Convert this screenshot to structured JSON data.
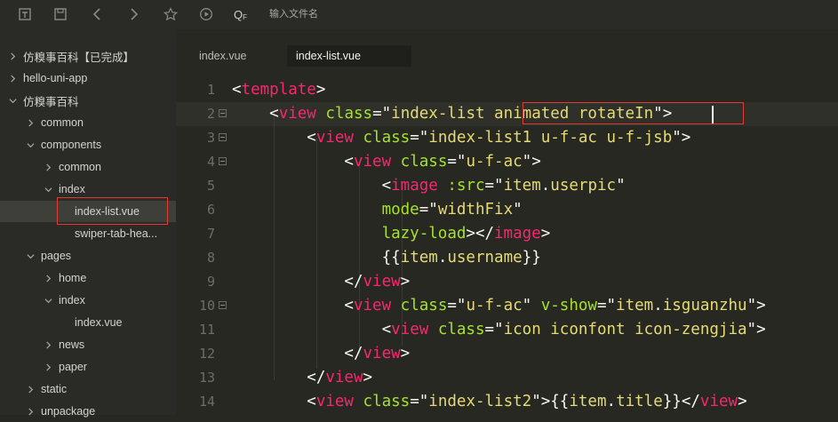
{
  "toolbar": {
    "icons": [
      "new-file-icon",
      "save-icon",
      "back-icon",
      "forward-icon",
      "star-icon",
      "run-icon"
    ],
    "search_glyph": "Q",
    "search_subscript": "F",
    "search_placeholder": "输入文件名"
  },
  "sidebar": {
    "items": [
      {
        "label": "仿糗事百科【已完成】",
        "expanded": false
      },
      {
        "label": "hello-uni-app",
        "expanded": false
      },
      {
        "label": "仿糗事百科",
        "expanded": true
      },
      {
        "label": "common",
        "expanded": false
      },
      {
        "label": "components",
        "expanded": true
      },
      {
        "label": "common",
        "expanded": false
      },
      {
        "label": "index",
        "expanded": true
      },
      {
        "label": "index-list.vue",
        "selected": true
      },
      {
        "label": "swiper-tab-hea..."
      },
      {
        "label": "pages",
        "expanded": true
      },
      {
        "label": "home",
        "expanded": false
      },
      {
        "label": "index",
        "expanded": true
      },
      {
        "label": "index.vue"
      },
      {
        "label": "news",
        "expanded": false
      },
      {
        "label": "paper",
        "expanded": false
      },
      {
        "label": "static",
        "expanded": false
      },
      {
        "label": "unpackage",
        "expanded": false
      }
    ]
  },
  "tabs": [
    {
      "label": "index.vue",
      "active": false
    },
    {
      "label": "index-list.vue",
      "active": true
    }
  ],
  "editor": {
    "lines": [
      {
        "n": "1",
        "parts": [
          [
            "t",
            "<"
          ],
          [
            "tag",
            "template"
          ],
          [
            "t",
            ">"
          ]
        ]
      },
      {
        "n": "2",
        "parts": [
          [
            "t",
            "    <"
          ],
          [
            "tag",
            "view"
          ],
          [
            "t",
            " "
          ],
          [
            "attr",
            "class"
          ],
          [
            "t",
            "=\""
          ],
          [
            "str",
            "index-list animated rotateIn"
          ],
          [
            "t",
            "\">"
          ]
        ]
      },
      {
        "n": "3",
        "parts": [
          [
            "t",
            "        <"
          ],
          [
            "tag",
            "view"
          ],
          [
            "t",
            " "
          ],
          [
            "attr",
            "class"
          ],
          [
            "t",
            "=\""
          ],
          [
            "str",
            "index-list1 u-f-ac u-f-jsb"
          ],
          [
            "t",
            "\">"
          ]
        ]
      },
      {
        "n": "4",
        "parts": [
          [
            "t",
            "            <"
          ],
          [
            "tag",
            "view"
          ],
          [
            "t",
            " "
          ],
          [
            "attr",
            "class"
          ],
          [
            "t",
            "=\""
          ],
          [
            "str",
            "u-f-ac"
          ],
          [
            "t",
            "\">"
          ]
        ]
      },
      {
        "n": "5",
        "parts": [
          [
            "t",
            "                <"
          ],
          [
            "tag",
            "image"
          ],
          [
            "t",
            " "
          ],
          [
            "attr",
            ":src"
          ],
          [
            "t",
            "=\""
          ],
          [
            "str",
            "item"
          ],
          [
            "t",
            "."
          ],
          [
            "str",
            "userpic"
          ],
          [
            "t",
            "\""
          ]
        ]
      },
      {
        "n": "6",
        "parts": [
          [
            "t",
            "                "
          ],
          [
            "attr",
            "mode"
          ],
          [
            "t",
            "=\""
          ],
          [
            "str",
            "widthFix"
          ],
          [
            "t",
            "\""
          ]
        ]
      },
      {
        "n": "7",
        "parts": [
          [
            "t",
            "                "
          ],
          [
            "attr",
            "lazy-load"
          ],
          [
            "t",
            "></"
          ],
          [
            "tag",
            "image"
          ],
          [
            "t",
            ">"
          ]
        ]
      },
      {
        "n": "8",
        "parts": [
          [
            "t",
            "                {{"
          ],
          [
            "str",
            "item"
          ],
          [
            "t",
            "."
          ],
          [
            "str",
            "username"
          ],
          [
            "t",
            "}}"
          ]
        ]
      },
      {
        "n": "9",
        "parts": [
          [
            "t",
            "            </"
          ],
          [
            "tag",
            "view"
          ],
          [
            "t",
            ">"
          ]
        ]
      },
      {
        "n": "10",
        "parts": [
          [
            "t",
            "            <"
          ],
          [
            "tag",
            "view"
          ],
          [
            "t",
            " "
          ],
          [
            "attr",
            "class"
          ],
          [
            "t",
            "=\""
          ],
          [
            "str",
            "u-f-ac"
          ],
          [
            "t",
            "\" "
          ],
          [
            "attr",
            "v-show"
          ],
          [
            "t",
            "=\""
          ],
          [
            "str",
            "item"
          ],
          [
            "t",
            "."
          ],
          [
            "str",
            "isguanzhu"
          ],
          [
            "t",
            "\">"
          ]
        ]
      },
      {
        "n": "11",
        "parts": [
          [
            "t",
            "                <"
          ],
          [
            "tag",
            "view"
          ],
          [
            "t",
            " "
          ],
          [
            "attr",
            "class"
          ],
          [
            "t",
            "=\""
          ],
          [
            "str",
            "icon iconfont icon-zengjia"
          ],
          [
            "t",
            "\">"
          ]
        ]
      },
      {
        "n": "12",
        "parts": [
          [
            "t",
            "            </"
          ],
          [
            "tag",
            "view"
          ],
          [
            "t",
            ">"
          ]
        ]
      },
      {
        "n": "13",
        "parts": [
          [
            "t",
            "        </"
          ],
          [
            "tag",
            "view"
          ],
          [
            "t",
            ">"
          ]
        ]
      },
      {
        "n": "14",
        "parts": [
          [
            "t",
            "        <"
          ],
          [
            "tag",
            "view"
          ],
          [
            "t",
            " "
          ],
          [
            "attr",
            "class"
          ],
          [
            "t",
            "=\""
          ],
          [
            "str",
            "index-list2"
          ],
          [
            "t",
            "\">{{"
          ],
          [
            "str",
            "item"
          ],
          [
            "t",
            "."
          ],
          [
            "str",
            "title"
          ],
          [
            "t",
            "}}</"
          ],
          [
            "tag",
            "view"
          ],
          [
            "t",
            ">"
          ]
        ]
      }
    ]
  },
  "colors": {
    "tag": "#f92672",
    "attr": "#a6e22e",
    "string": "#e6db74",
    "highlight_box": "#e03c31"
  }
}
